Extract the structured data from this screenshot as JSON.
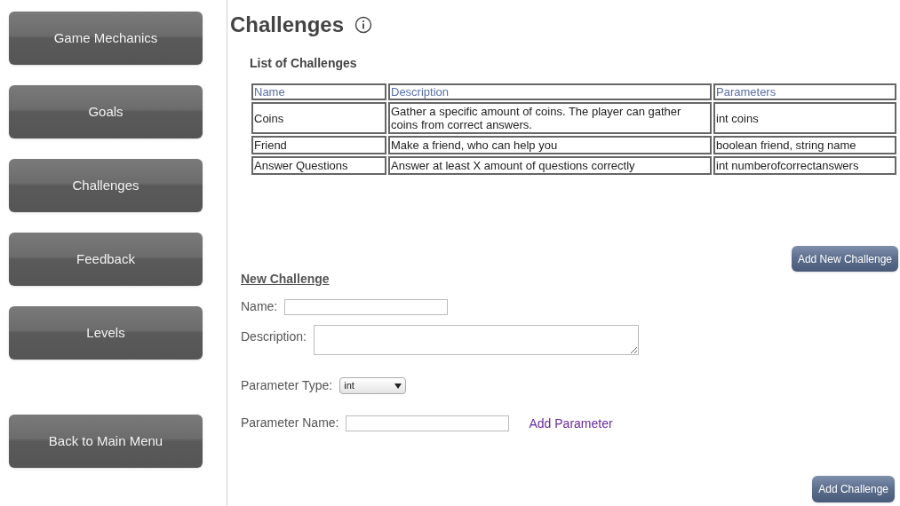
{
  "sidebar": {
    "items": [
      {
        "label": "Game Mechanics"
      },
      {
        "label": "Goals"
      },
      {
        "label": "Challenges"
      },
      {
        "label": "Feedback"
      },
      {
        "label": "Levels"
      },
      {
        "label": "Back to Main Menu"
      }
    ]
  },
  "page": {
    "title": "Challenges"
  },
  "list": {
    "title": "List of Challenges",
    "columns": [
      "Name",
      "Description",
      "Parameters"
    ],
    "rows": [
      {
        "cells": [
          "Coins",
          "Gather a specific amount of coins. The player can gather coins from correct answers.",
          "int coins"
        ]
      },
      {
        "cells": [
          "Friend",
          "Make a friend, who can help you",
          "boolean friend, string name"
        ]
      },
      {
        "cells": [
          "Answer Questions",
          "Answer at least X amount of questions correctly",
          "int numberofcorrectanswers"
        ]
      }
    ]
  },
  "add_new_button": "Add New Challenge",
  "form": {
    "title": "New Challenge",
    "name_label": "Name:",
    "description_label": "Description:",
    "type_label": "Parameter Type:",
    "type_value": "int",
    "param_label": "Parameter Name:",
    "add_parameter_link": "Add Parameter"
  },
  "submit_button": "Add Challenge"
}
